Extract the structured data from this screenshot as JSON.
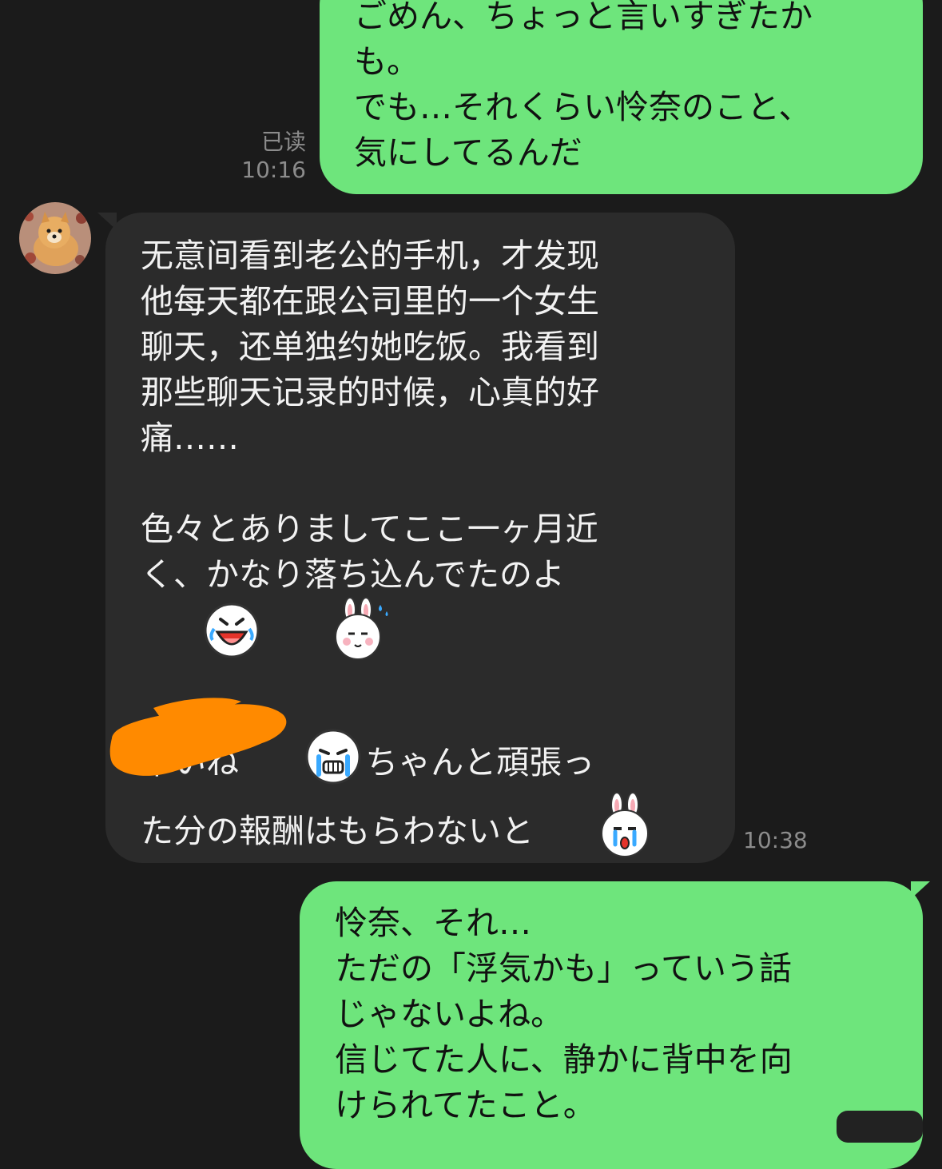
{
  "messages": {
    "m1": {
      "text": "ごめん、ちょっと言いすぎたか\nも。\nでも…それくらい怜奈のこと、\n気にしてるんだ",
      "read": "已读",
      "time": "10:16"
    },
    "m2": {
      "text_cn": "无意间看到老公的手机，才发现\n他每天都在跟公司里的一个女生\n聊天，还单独约她吃饭。我看到\n那些聊天记录的时候，心真的好\n痛……",
      "text_jp": "色々とありましてここ一ヶ月近\nく、かなり落ち込んでたのよ",
      "line3_a": "辛いね",
      "line3_b": "ちゃんと頑張っ",
      "line4": "た分の報酬はもらわないと",
      "time": "10:38",
      "emojis": [
        "laughing-face-icon",
        "bunny-sweat-icon",
        "crying-face-icon",
        "bunny-crying-icon"
      ]
    },
    "m3": {
      "text": "怜奈、それ…\nただの「浮気かも」っていう話\nじゃないよね。\n信じてた人に、静かに背中を向\nけられてたこと。"
    }
  },
  "colors": {
    "background": "#1b1b1b",
    "outgoing": "#6ee57c",
    "incoming": "#2b2b2b",
    "scribble": "#ff8a00"
  }
}
